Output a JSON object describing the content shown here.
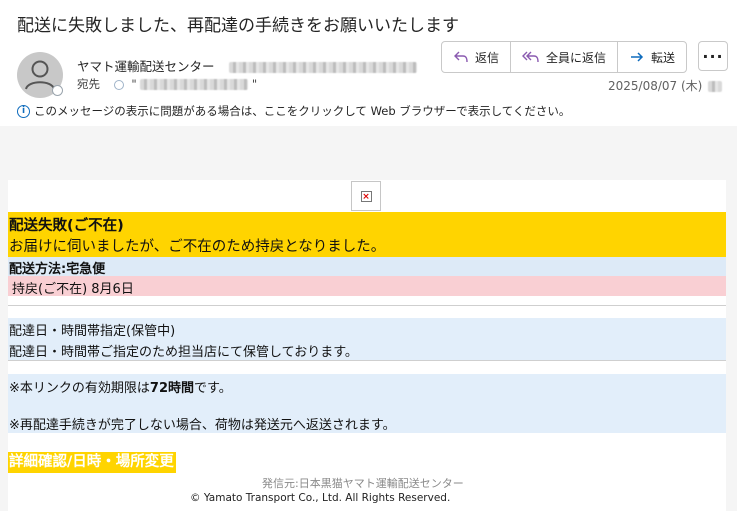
{
  "subject": "配送に失敗しました、再配達の手続きをお願いいたします",
  "sender": {
    "name": "ヤマト運輸配送センター"
  },
  "recipient_label": "宛先",
  "recipient_quote_open": "\"",
  "recipient_quote_close": "\"",
  "actions": {
    "reply": "返信",
    "reply_all": "全員に返信",
    "forward": "転送",
    "more": "···"
  },
  "date": "2025/08/07 (木)",
  "info_bar": "このメッセージの表示に問題がある場合は、ここをクリックして Web ブラウザーで表示してください。",
  "body": {
    "status_title": "配送失敗(ご不在)",
    "status_desc": "お届けに伺いましたが、ご不在のため持戻となりました。",
    "method": "配送方法:宅急便",
    "return_note": "持戻(ご不在) 8月6日",
    "hold_title": "配達日・時間帯指定(保管中)",
    "hold_desc": "配達日・時間帯ご指定のため担当店にて保管しております。",
    "expiry_prefix": "※本リンクの有効期限は",
    "expiry_bold": "72時間",
    "expiry_suffix": "です。",
    "return_warning": "※再配達手続きが完了しない場合、荷物は発送元へ返送されます。",
    "link": "詳細確認/日時・場所変更",
    "sender_footer": "発信元:日本黒猫ヤマト運輸配送センター",
    "copyright": "© Yamato Transport Co., Ltd. All Rights Reserved."
  },
  "colors": {
    "highlight_yellow": "#ffd400",
    "pink": "#f9cfd3",
    "light_blue": "#e2eefa",
    "accent_blue": "#0f6cbd",
    "reply_all_purple": "#8a5ab0"
  }
}
